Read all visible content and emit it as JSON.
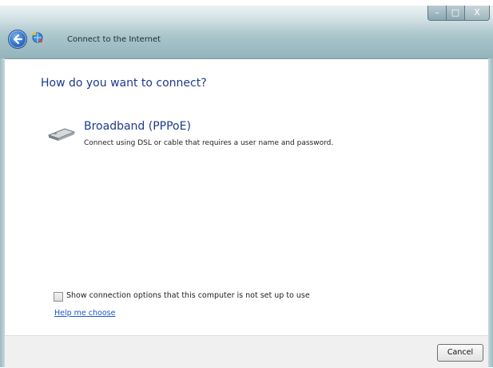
{
  "window": {
    "title": "Connect to the Internet",
    "controls": {
      "minimize": "–",
      "maximize": "□",
      "close": "X"
    }
  },
  "main": {
    "heading": "How do you want to connect?",
    "option": {
      "title": "Broadband (PPPoE)",
      "description": "Connect using DSL or cable that requires a user name and password.",
      "icon": "modem-icon"
    },
    "show_options_label": "Show connection options that this computer is not set up to use",
    "show_options_checked": false,
    "help_link": "Help me choose"
  },
  "footer": {
    "cancel_label": "Cancel"
  },
  "colors": {
    "heading": "#1e3a8c",
    "link": "#1a57c9",
    "titlebar": "#a9c4cb"
  }
}
